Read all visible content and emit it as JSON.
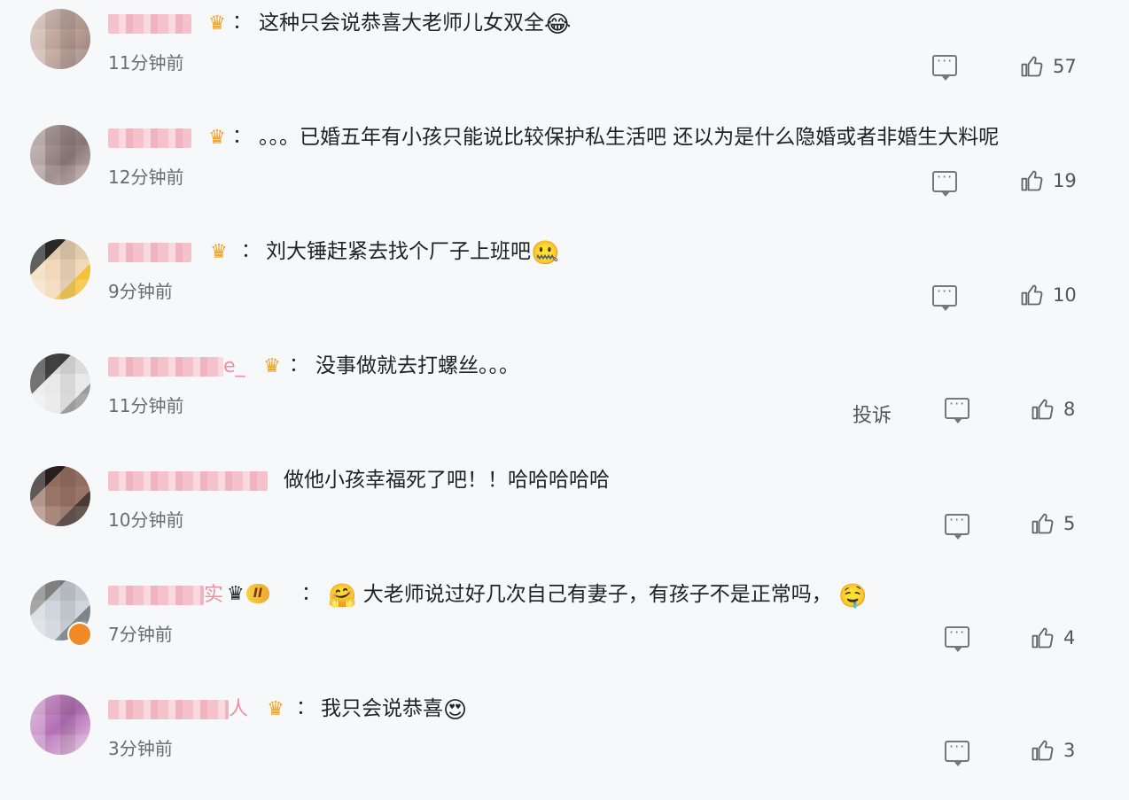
{
  "comments": [
    {
      "text": "这种只会说恭喜大老师儿女双全",
      "emoji": "😂",
      "time": "11分钟前",
      "likes": "57"
    },
    {
      "text": "。。。已婚五年有小孩只能说比较保护私生活吧 还以为是什么隐婚或者非婚生大料呢",
      "time": "12分钟前",
      "likes": "19"
    },
    {
      "text": "刘大锤赶紧去找个厂子上班吧",
      "emoji": "🤐",
      "time": "9分钟前",
      "likes": "10"
    },
    {
      "name_suffix": "e_",
      "text": "没事做就去打螺丝。。。",
      "time": "11分钟前",
      "report": "投诉",
      "likes": "8"
    },
    {
      "text": "做他小孩幸福死了吧！！哈哈哈哈哈",
      "time": "10分钟前",
      "likes": "5"
    },
    {
      "name_suffix": "实",
      "level": "II",
      "emoji_lead": "🤗",
      "text": "大老师说过好几次自己有妻子，有孩子不是正常吗，",
      "emoji": "🤤",
      "time": "7分钟前",
      "likes": "4"
    },
    {
      "name_suffix": "人",
      "text": "我只会说恭喜",
      "emoji": "😍",
      "time": "3分钟前",
      "likes": "3"
    }
  ],
  "colon": "：",
  "colors": {
    "background": "#f7f8fa",
    "username_blur": "#f5b9c4",
    "crown": "#f2a020",
    "time": "#6b6b6b"
  },
  "icons": [
    "crown-icon",
    "reply-icon",
    "thumbs-up-icon"
  ]
}
